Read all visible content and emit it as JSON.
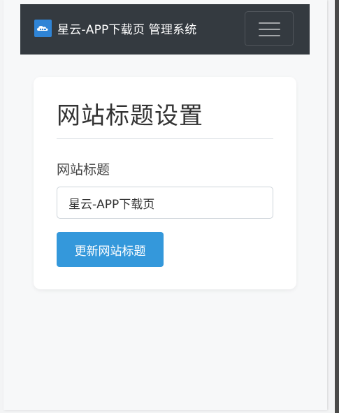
{
  "navbar": {
    "brand_text": "星云-APP下载页 管理系统",
    "logo_icon": "cloud-icon",
    "menu_icon": "hamburger-menu-icon",
    "background_color": "#343a40",
    "logo_color": "#2f84d6"
  },
  "card": {
    "title": "网站标题设置",
    "field_label": "网站标题",
    "input_value": "星云-APP下载页",
    "button_label": "更新网站标题",
    "button_color": "#3498db"
  }
}
